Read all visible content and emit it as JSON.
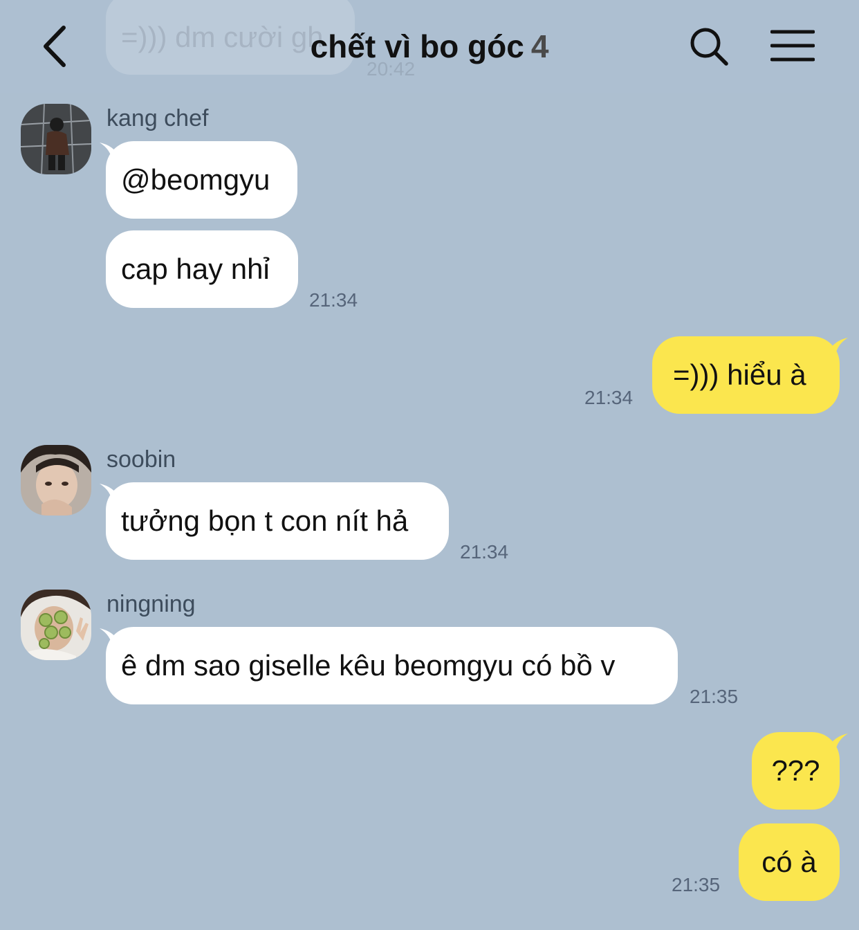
{
  "header": {
    "title": "chết vì bo góc",
    "member_count": "4",
    "background_preview_text": "=))) dm cười gh",
    "background_preview_time": "20:42"
  },
  "messages": [
    {
      "sender": "kang chef",
      "text": "@beomgyu"
    },
    {
      "text": "cap hay nhỉ",
      "time": "21:34"
    },
    {
      "text": "=))) hiểu à",
      "time": "21:34"
    },
    {
      "sender": "soobin",
      "text": "tưởng bọn t con nít hả",
      "time": "21:34"
    },
    {
      "sender": "ningning",
      "text": "ê dm sao giselle kêu beomgyu có bồ v",
      "time": "21:35"
    },
    {
      "text": "???"
    },
    {
      "text": "có à",
      "time": "21:35"
    }
  ],
  "colors": {
    "background": "#adbfd0",
    "incoming_bubble": "#ffffff",
    "outgoing_bubble": "#fbe64e"
  },
  "icons": [
    "back-arrow-icon",
    "search-icon",
    "menu-icon"
  ]
}
